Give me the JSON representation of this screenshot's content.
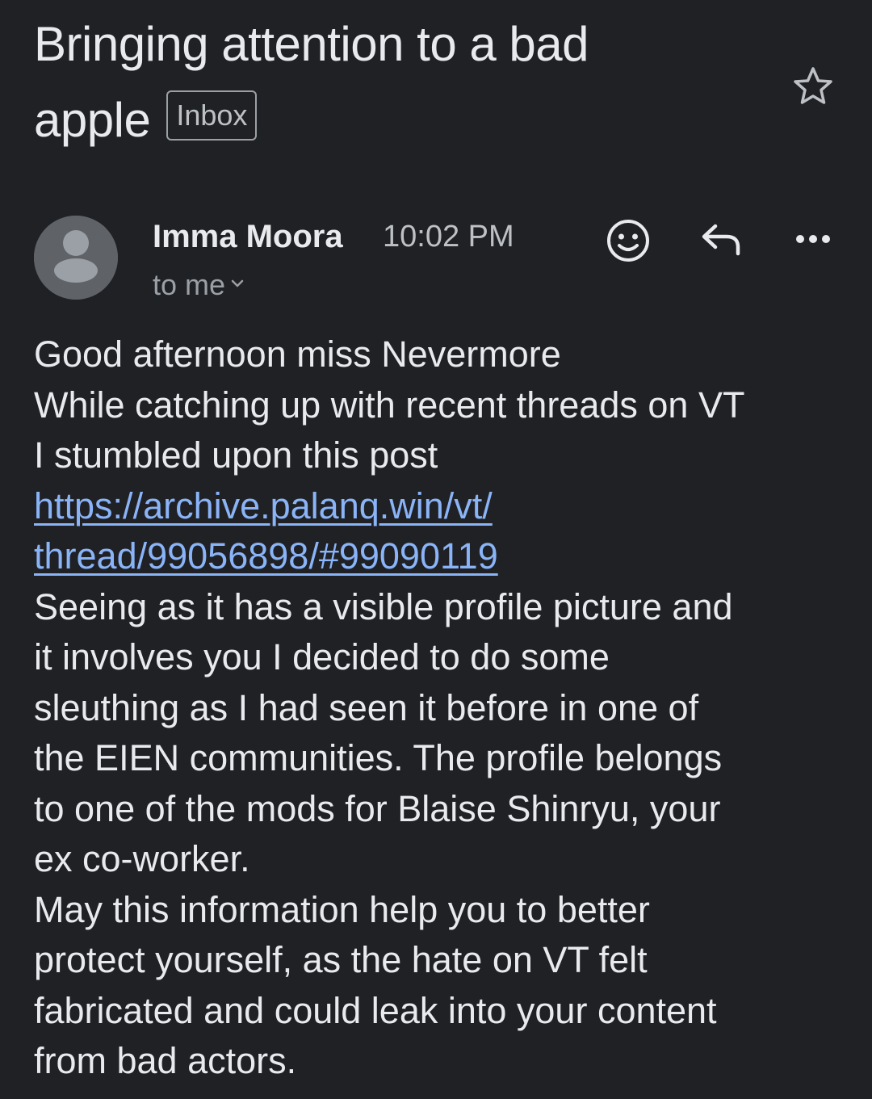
{
  "email": {
    "subject_line1": "Bringing attention to a bad",
    "subject_line2": "apple",
    "label_chip": "Inbox",
    "sender_name": "Imma Moora",
    "time": "10:02 PM",
    "recipient": "to me",
    "body_lines": [
      "Good afternoon miss Nevermore",
      "While catching up with recent threads on VT",
      "I stumbled upon this post",
      "https://archive.palanq.win/vt/",
      "thread/99056898/#99090119",
      "Seeing as it has a visible profile picture and",
      "it involves you I decided to do some",
      "sleuthing as I had seen it before in one of",
      "the EIEN communities. The profile belongs",
      "to one of the mods for Blaise Shinryu, your",
      "ex co-worker.",
      "May this information help you to better",
      "protect yourself, as the hate on VT felt",
      "fabricated and could leak into your content",
      "from bad actors."
    ]
  },
  "icons": {
    "star": "star-icon",
    "avatar": "person-icon",
    "emoji": "smiley-icon",
    "reply": "reply-icon",
    "more": "more-horizontal-icon",
    "chevron": "chevron-down-icon"
  },
  "colors": {
    "background": "#202124",
    "text": "#e8eaed",
    "muted": "#9aa0a6",
    "link": "#8ab4f8"
  }
}
